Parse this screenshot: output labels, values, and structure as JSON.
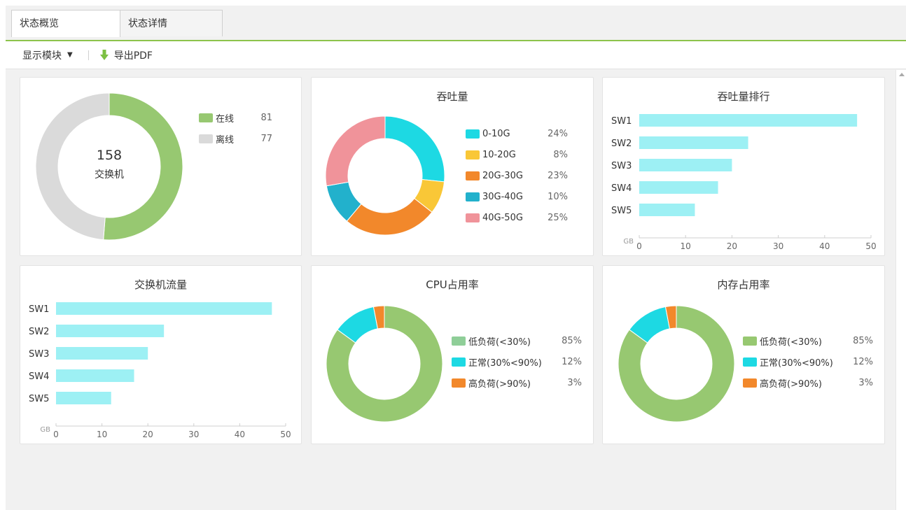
{
  "tabs": [
    {
      "label": "状态概览",
      "active": true
    },
    {
      "label": "状态详情",
      "active": false
    }
  ],
  "toolbar": {
    "modules_label": "显示模块",
    "export_label": "导出PDF"
  },
  "colors": {
    "accent": "#8cc34b",
    "online": "#97c871",
    "offline": "#dadada",
    "bar": "#9df0f4",
    "cyan": "#1dd9e3",
    "yellow": "#f9c737",
    "orange": "#f2882b",
    "blue": "#22b1cc",
    "pink": "#f0939a",
    "green": "#97c871",
    "lightgreen": "#8fce98"
  },
  "switch_summary": {
    "total": "158",
    "total_label": "交换机",
    "legend": [
      {
        "label": "在线",
        "value": "81"
      },
      {
        "label": "离线",
        "value": "77"
      }
    ]
  },
  "throughput": {
    "title": "吞吐量",
    "legend": [
      {
        "label": "0-10G",
        "value": "24%"
      },
      {
        "label": "10-20G",
        "value": "8%"
      },
      {
        "label": "20G-30G",
        "value": "23%"
      },
      {
        "label": "30G-40G",
        "value": "10%"
      },
      {
        "label": "40G-50G",
        "value": "25%"
      }
    ]
  },
  "ranking": {
    "title": "吞吐量排行"
  },
  "switch_traffic": {
    "title": "交换机流量"
  },
  "cpu": {
    "title": "CPU占用率",
    "legend": [
      {
        "label": "低负荷(<30%)",
        "value": "85%"
      },
      {
        "label": "正常(30%<90%)",
        "value": "12%"
      },
      {
        "label": "高负荷(>90%)",
        "value": "3%"
      }
    ]
  },
  "memory": {
    "title": "内存占用率",
    "legend": [
      {
        "label": "低负荷(<30%)",
        "value": "85%"
      },
      {
        "label": "正常(30%<90%)",
        "value": "12%"
      },
      {
        "label": "高负荷(>90%)",
        "value": "3%"
      }
    ]
  },
  "chart_data": [
    {
      "type": "pie",
      "chart": "switch_summary",
      "categories": [
        "在线",
        "离线"
      ],
      "values": [
        81,
        77
      ]
    },
    {
      "type": "pie",
      "chart": "throughput",
      "title": "吞吐量",
      "categories": [
        "0-10G",
        "10-20G",
        "20G-30G",
        "30G-40G",
        "40G-50G"
      ],
      "values": [
        24,
        8,
        23,
        10,
        25
      ]
    },
    {
      "type": "bar",
      "chart": "ranking",
      "title": "吞吐量排行",
      "orientation": "horizontal",
      "categories": [
        "SW1",
        "SW2",
        "SW3",
        "SW4",
        "SW5"
      ],
      "values": [
        47,
        23.5,
        20,
        17,
        12
      ],
      "xlabel": "GB",
      "xlim": [
        0,
        50
      ],
      "xticks": [
        "0",
        "10",
        "20",
        "30",
        "40",
        "50"
      ],
      "grid": false
    },
    {
      "type": "bar",
      "chart": "switch_traffic",
      "title": "交换机流量",
      "orientation": "horizontal",
      "categories": [
        "SW1",
        "SW2",
        "SW3",
        "SW4",
        "SW5"
      ],
      "values": [
        47,
        23.5,
        20,
        17,
        12
      ],
      "xlabel": "GB",
      "xlim": [
        0,
        50
      ],
      "xticks": [
        "0",
        "10",
        "20",
        "30",
        "40",
        "50"
      ],
      "grid": false
    },
    {
      "type": "pie",
      "chart": "cpu",
      "title": "CPU占用率",
      "categories": [
        "低负荷(<30%)",
        "正常(30%<90%)",
        "高负荷(>90%)"
      ],
      "values": [
        85,
        12,
        3
      ]
    },
    {
      "type": "pie",
      "chart": "memory",
      "title": "内存占用率",
      "categories": [
        "低负荷(<30%)",
        "正常(30%<90%)",
        "高负荷(>90%)"
      ],
      "values": [
        85,
        12,
        3
      ]
    }
  ]
}
